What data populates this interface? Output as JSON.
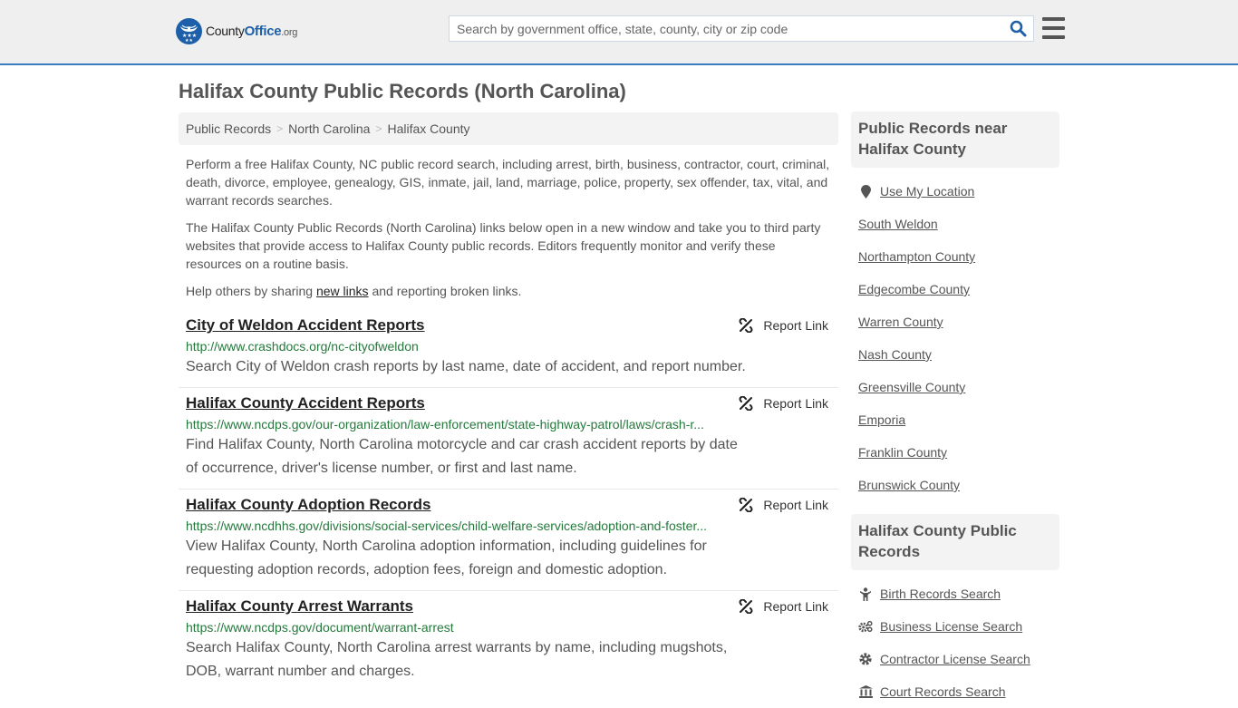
{
  "header": {
    "logo": {
      "brand_county": "County",
      "brand_office": "Office",
      "brand_tld": ".org"
    },
    "search": {
      "placeholder": "Search by government office, state, county, city or zip code",
      "value": ""
    },
    "icons": {
      "search": "search-icon",
      "menu": "hamburger-menu-icon"
    }
  },
  "page": {
    "title": "Halifax County Public Records (North Carolina)"
  },
  "breadcrumb": [
    {
      "label": "Public Records"
    },
    {
      "label": "North Carolina"
    },
    {
      "label": "Halifax County"
    }
  ],
  "intro": {
    "p1": "Perform a free Halifax County, NC public record search, including arrest, birth, business, contractor, court, criminal, death, divorce, employee, genealogy, GIS, inmate, jail, land, marriage, police, property, sex offender, tax, vital, and warrant records searches.",
    "p2": "The Halifax County Public Records (North Carolina) links below open in a new window and take you to third party websites that provide access to Halifax County public records. Editors frequently monitor and verify these resources on a routine basis.",
    "p3_before": "Help others by sharing ",
    "p3_link": "new links",
    "p3_after": " and reporting broken links."
  },
  "entries": [
    {
      "title": "City of Weldon Accident Reports",
      "url": "http://www.crashdocs.org/nc-cityofweldon",
      "description": "Search City of Weldon crash reports by last name, date of accident, and report number.",
      "report_label": "Report Link"
    },
    {
      "title": "Halifax County Accident Reports",
      "url": "https://www.ncdps.gov/our-organization/law-enforcement/state-highway-patrol/laws/crash-r...",
      "description": "Find Halifax County, North Carolina motorcycle and car crash accident reports by date of occurrence, driver's license number, or first and last name.",
      "report_label": "Report Link"
    },
    {
      "title": "Halifax County Adoption Records",
      "url": "https://www.ncdhhs.gov/divisions/social-services/child-welfare-services/adoption-and-foster...",
      "description": "View Halifax County, North Carolina adoption information, including guidelines for requesting adoption records, adoption fees, foreign and domestic adoption.",
      "report_label": "Report Link"
    },
    {
      "title": "Halifax County Arrest Warrants",
      "url": "https://www.ncdps.gov/document/warrant-arrest",
      "description": "Search Halifax County, North Carolina arrest warrants by name, including mugshots, DOB, warrant number and charges.",
      "report_label": "Report Link"
    }
  ],
  "sidebar": {
    "nearby": {
      "heading": "Public Records near Halifax County",
      "use_location": "Use My Location",
      "items": [
        {
          "label": "South Weldon"
        },
        {
          "label": "Northampton County"
        },
        {
          "label": "Edgecombe County"
        },
        {
          "label": "Warren County"
        },
        {
          "label": "Nash County"
        },
        {
          "label": "Greensville County"
        },
        {
          "label": "Emporia"
        },
        {
          "label": "Franklin County"
        },
        {
          "label": "Brunswick County"
        }
      ]
    },
    "records": {
      "heading": "Halifax County Public Records",
      "items": [
        {
          "label": "Birth Records Search",
          "icon": "child-icon"
        },
        {
          "label": "Business License Search",
          "icon": "cogs-icon"
        },
        {
          "label": "Contractor License Search",
          "icon": "gear-icon"
        },
        {
          "label": "Court Records Search",
          "icon": "courthouse-icon"
        }
      ]
    }
  }
}
